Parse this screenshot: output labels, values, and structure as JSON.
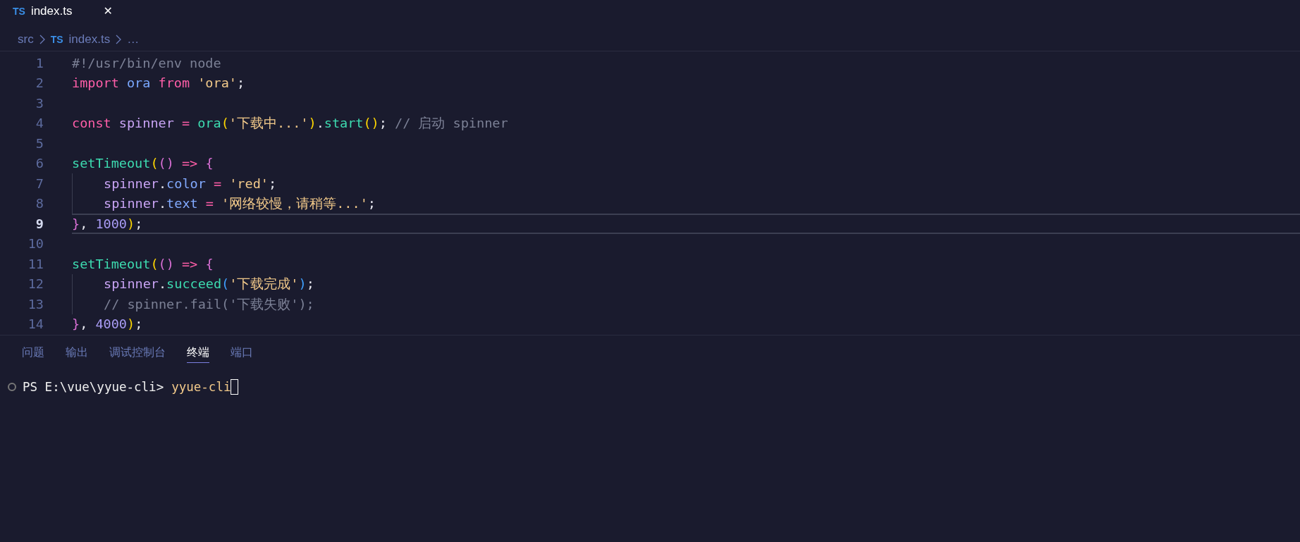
{
  "tabs": [
    {
      "icon": "TS",
      "label": "index.ts",
      "selected": true,
      "close": "✕"
    }
  ],
  "breadcrumb": [
    {
      "label": "src"
    },
    {
      "label": "index.ts",
      "icon": "TS"
    },
    {
      "label": "…"
    }
  ],
  "code_lines": [
    {
      "number": "1",
      "current": false,
      "tokens": [
        {
          "text": "#!/usr/bin/env node",
          "kind": "comment"
        }
      ]
    },
    {
      "number": "2",
      "current": false,
      "tokens": [
        {
          "text": "import",
          "kind": "keyword"
        },
        {
          "text": " ora",
          "kind": "identifier"
        },
        {
          "text": " from",
          "kind": "keyword"
        },
        {
          "text": " 'ora'",
          "kind": "string"
        },
        {
          "text": ";",
          "kind": "plain"
        }
      ]
    },
    {
      "number": "3",
      "current": false
    },
    {
      "number": "4",
      "current": false,
      "tokens": [
        {
          "text": "const",
          "kind": "keyword"
        },
        {
          "text": " spinner",
          "kind": "variable"
        },
        {
          "text": " = ",
          "kind": "operator"
        },
        {
          "text": "ora",
          "kind": "function"
        },
        {
          "text": "(",
          "kind": "bracket1"
        },
        {
          "text": "'下载中...'",
          "kind": "string"
        },
        {
          "text": ")",
          "kind": "bracket1"
        },
        {
          "text": ".",
          "kind": "plain"
        },
        {
          "text": "start",
          "kind": "function"
        },
        {
          "text": "()",
          "kind": "bracket1"
        },
        {
          "text": "; ",
          "kind": "plain"
        },
        {
          "text": "// 启动 spinner",
          "kind": "comment"
        }
      ]
    },
    {
      "number": "5",
      "current": false
    },
    {
      "number": "6",
      "current": false,
      "tokens": [
        {
          "text": "setTimeout",
          "kind": "function"
        },
        {
          "text": "(",
          "kind": "bracket1"
        },
        {
          "text": "()",
          "kind": "bracket2"
        },
        {
          "text": " => ",
          "kind": "operator"
        },
        {
          "text": "{",
          "kind": "bracket2"
        }
      ],
      "children": [
        {
          "number": "7",
          "current": false,
          "tokens": [
            {
              "text": "spinner",
              "kind": "variable"
            },
            {
              "text": ".",
              "kind": "plain"
            },
            {
              "text": "color",
              "kind": "property"
            },
            {
              "text": " = ",
              "kind": "operator"
            },
            {
              "text": "'red'",
              "kind": "string"
            },
            {
              "text": ";",
              "kind": "plain"
            }
          ]
        },
        {
          "number": "8",
          "current": false,
          "tokens": [
            {
              "text": "spinner",
              "kind": "variable"
            },
            {
              "text": ".",
              "kind": "plain"
            },
            {
              "text": "text",
              "kind": "property"
            },
            {
              "text": " = ",
              "kind": "operator"
            },
            {
              "text": "'网络较慢，请稍等...'",
              "kind": "string"
            },
            {
              "text": ";",
              "kind": "plain"
            }
          ]
        }
      ]
    },
    {
      "number": "9",
      "current": true,
      "tokens": [
        {
          "text": "}",
          "kind": "bracket2"
        },
        {
          "text": ", ",
          "kind": "plain"
        },
        {
          "text": "1000",
          "kind": "number"
        },
        {
          "text": ")",
          "kind": "bracket1"
        },
        {
          "text": ";",
          "kind": "plain"
        }
      ]
    },
    {
      "number": "10",
      "current": false
    },
    {
      "number": "11",
      "current": false,
      "tokens": [
        {
          "text": "setTimeout",
          "kind": "function"
        },
        {
          "text": "(",
          "kind": "bracket1"
        },
        {
          "text": "()",
          "kind": "bracket2"
        },
        {
          "text": " => ",
          "kind": "operator"
        },
        {
          "text": "{",
          "kind": "bracket2"
        }
      ],
      "children": [
        {
          "number": "12",
          "current": false,
          "tokens": [
            {
              "text": "spinner",
              "kind": "variable"
            },
            {
              "text": ".",
              "kind": "plain"
            },
            {
              "text": "succeed",
              "kind": "function"
            },
            {
              "text": "(",
              "kind": "bracket3"
            },
            {
              "text": "'下载完成'",
              "kind": "string"
            },
            {
              "text": ")",
              "kind": "bracket3"
            },
            {
              "text": ";",
              "kind": "plain"
            }
          ]
        },
        {
          "number": "13",
          "current": false,
          "tokens": [
            {
              "text": "// spinner.fail('下载失败');",
              "kind": "comment"
            }
          ]
        }
      ]
    },
    {
      "number": "14",
      "current": false,
      "tokens": [
        {
          "text": "}",
          "kind": "bracket2"
        },
        {
          "text": ", ",
          "kind": "plain"
        },
        {
          "text": "4000",
          "kind": "number"
        },
        {
          "text": ")",
          "kind": "bracket1"
        },
        {
          "text": ";",
          "kind": "plain"
        }
      ]
    }
  ],
  "panel_tabs": [
    {
      "label": "问题",
      "selected": false
    },
    {
      "label": "输出",
      "selected": false
    },
    {
      "label": "调试控制台",
      "selected": false
    },
    {
      "label": "终端",
      "selected": true
    },
    {
      "label": "端口",
      "selected": false
    }
  ],
  "terminal": {
    "prompt": "PS E:\\vue\\yyue-cli>",
    "command": "yyue-cli"
  }
}
